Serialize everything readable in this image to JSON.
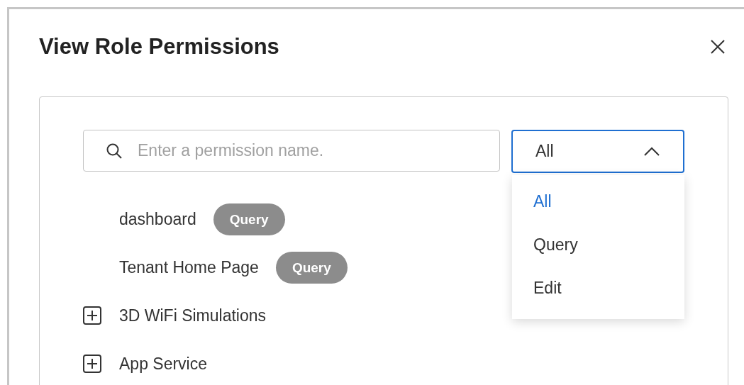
{
  "dialog": {
    "title": "View Role Permissions"
  },
  "search": {
    "placeholder": "Enter a permission name."
  },
  "filter": {
    "value": "All",
    "expanded": true,
    "options": [
      {
        "label": "All",
        "selected": true
      },
      {
        "label": "Query",
        "selected": false
      },
      {
        "label": "Edit",
        "selected": false
      }
    ]
  },
  "tree": [
    {
      "kind": "leaf",
      "label": "dashboard",
      "tag": "Query"
    },
    {
      "kind": "leaf",
      "label": "Tenant Home Page",
      "tag": "Query"
    },
    {
      "kind": "group",
      "label": "3D WiFi Simulations",
      "expanded": false
    },
    {
      "kind": "group",
      "label": "App Service",
      "expanded": false
    }
  ]
}
